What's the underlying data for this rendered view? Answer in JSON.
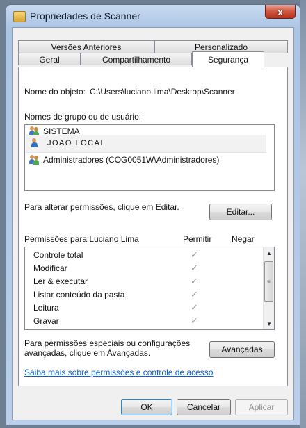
{
  "window": {
    "title": "Propriedades de Scanner",
    "close_glyph": "x"
  },
  "tabs": {
    "row_top": [
      "Versões Anteriores",
      "Personalizado"
    ],
    "row_bottom": [
      "Geral",
      "Compartilhamento",
      "Segurança"
    ],
    "active": "Segurança"
  },
  "object": {
    "label": "Nome do objeto:",
    "path": "C:\\Users\\luciano.lima\\Desktop\\Scanner"
  },
  "groups": {
    "label": "Nomes de grupo ou de usuário:",
    "items": [
      {
        "name": "SISTEMA",
        "icon": "group-users-icon"
      },
      {
        "name": "JOAO LOCAL",
        "icon": "user-icon"
      },
      {
        "name": "Administradores (COG0051W\\Administradores)",
        "icon": "group-users-icon"
      }
    ]
  },
  "edit": {
    "prompt": "Para alterar permissões, clique em Editar.",
    "button": "Editar..."
  },
  "permissions": {
    "header_label": "Permissões para Luciano Lima",
    "allow_header": "Permitir",
    "deny_header": "Negar",
    "check_glyph": "✓",
    "items": [
      {
        "name": "Controle total",
        "allow": true,
        "deny": false
      },
      {
        "name": "Modificar",
        "allow": true,
        "deny": false
      },
      {
        "name": "Ler & executar",
        "allow": true,
        "deny": false
      },
      {
        "name": "Listar conteúdo da pasta",
        "allow": true,
        "deny": false
      },
      {
        "name": "Leitura",
        "allow": true,
        "deny": false
      },
      {
        "name": "Gravar",
        "allow": true,
        "deny": false
      }
    ]
  },
  "advanced": {
    "prompt_line1": "Para permissões especiais ou configurações",
    "prompt_line2": "avançadas, clique em Avançadas.",
    "button": "Avançadas"
  },
  "help_link": "Saiba mais sobre permissões e controle de acesso",
  "footer": {
    "ok": "OK",
    "cancel": "Cancelar",
    "apply": "Aplicar"
  }
}
